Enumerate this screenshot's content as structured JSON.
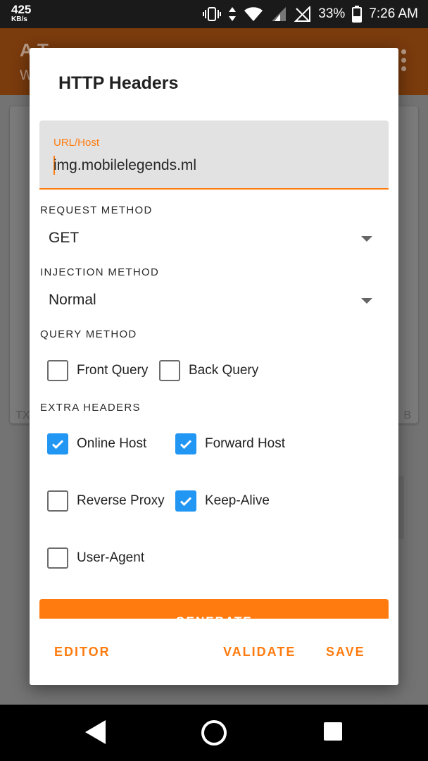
{
  "status_bar": {
    "net_speed": "425",
    "net_unit": "KB/s",
    "battery": "33%",
    "time": "7:26 AM"
  },
  "background_app": {
    "title_partial": "A      T",
    "subtitle_partial": "W",
    "card_left_fragment": "TX",
    "card_right_fragment": "B"
  },
  "dialog": {
    "title": "HTTP Headers",
    "url_field": {
      "label": "URL/Host",
      "value": "img.mobilelegends.ml"
    },
    "request_method": {
      "label": "REQUEST METHOD",
      "selected": "GET"
    },
    "injection_method": {
      "label": "INJECTION METHOD",
      "selected": "Normal"
    },
    "query_method": {
      "label": "QUERY METHOD",
      "options": [
        {
          "label": "Front Query",
          "checked": false
        },
        {
          "label": "Back Query",
          "checked": false
        }
      ]
    },
    "extra_headers": {
      "label": "EXTRA HEADERS",
      "options": [
        {
          "label": "Online Host",
          "checked": true
        },
        {
          "label": "Forward Host",
          "checked": true
        },
        {
          "label": "Reverse Proxy",
          "checked": false
        },
        {
          "label": "Keep-Alive",
          "checked": true
        },
        {
          "label": "User-Agent",
          "checked": false
        }
      ]
    },
    "generate_label": "GENERATE",
    "buttons": {
      "editor": "EDITOR",
      "validate": "VALIDATE",
      "save": "SAVE"
    }
  },
  "colors": {
    "accent": "#ff7b0f",
    "checkbox_checked": "#2196f3"
  },
  "nav_icons": [
    "back-icon",
    "home-icon",
    "recents-icon"
  ]
}
